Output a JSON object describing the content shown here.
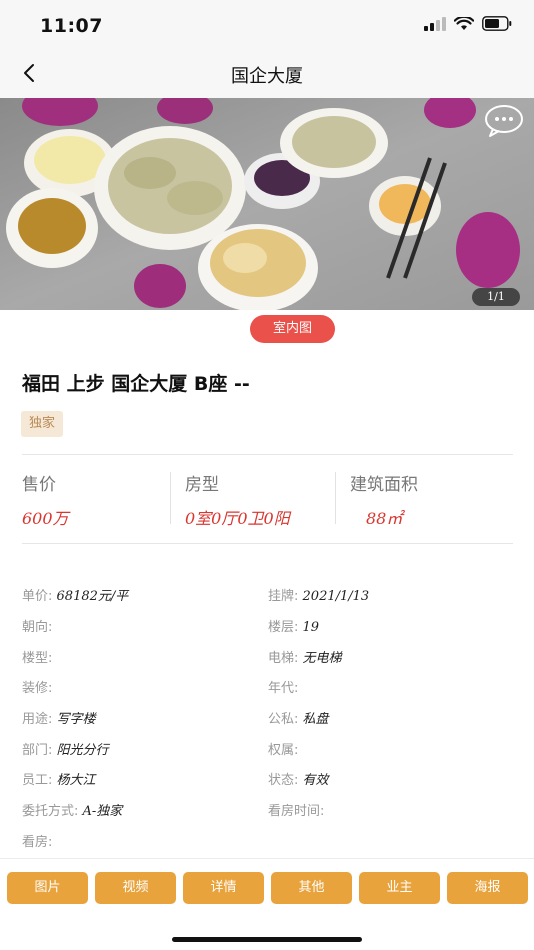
{
  "status_bar": {
    "time": "11:07"
  },
  "nav": {
    "title": "国企大厦"
  },
  "gallery": {
    "page_indicator": "1/1",
    "category_tag": "室内图"
  },
  "listing": {
    "title": "福田  上步  国企大厦  B座  --",
    "badge": "独家"
  },
  "stats": [
    {
      "label": "售价",
      "value": "600万"
    },
    {
      "label": "房型",
      "value": "0室0厅0卫0阳"
    },
    {
      "label": "建筑面积",
      "value": "88㎡"
    }
  ],
  "details": [
    {
      "label": "单价:",
      "value": "68182元/平"
    },
    {
      "label": "挂牌:",
      "value": "2021/1/13"
    },
    {
      "label": "朝向:",
      "value": ""
    },
    {
      "label": "楼层:",
      "value": "19"
    },
    {
      "label": "楼型:",
      "value": ""
    },
    {
      "label": "电梯:",
      "value": "无电梯"
    },
    {
      "label": "装修:",
      "value": ""
    },
    {
      "label": "年代:",
      "value": ""
    },
    {
      "label": "用途:",
      "value": "写字楼"
    },
    {
      "label": "公私:",
      "value": "私盘"
    },
    {
      "label": "部门:",
      "value": "阳光分行"
    },
    {
      "label": "权属:",
      "value": ""
    },
    {
      "label": "员工:",
      "value": "杨大江"
    },
    {
      "label": "状态:",
      "value": "有效"
    },
    {
      "label": "委托方式:",
      "value": "A-独家"
    },
    {
      "label": "看房时间:",
      "value": ""
    },
    {
      "label": "看房:",
      "value": ""
    }
  ],
  "actions": [
    "图片",
    "视频",
    "详情",
    "其他",
    "业主",
    "海报"
  ],
  "colors": {
    "accent_red": "#e9514a",
    "price_red": "#d9362f",
    "button_orange": "#e8a33d",
    "badge_bg": "#f5e8d6"
  }
}
